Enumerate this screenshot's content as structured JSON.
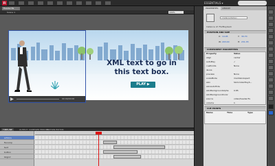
{
  "app": {
    "logo": "Fl",
    "workspace": "ESSENTIALS ▾"
  },
  "document": {
    "tab": "Header.fla",
    "scene": "Scene 1",
    "zoom": "100%"
  },
  "stage": {
    "headline": "XML text to go in this text box.",
    "play_button": "PLAY ▶",
    "video_time": "00:00/00:00"
  },
  "timeline": {
    "tabs": [
      "TIMELINE",
      "OUTPUT",
      "COMPILER ERRORS",
      "MOTION EDITOR"
    ],
    "layers": [
      "actions",
      "flvcomp",
      "text",
      "button",
      "bkgnd"
    ]
  },
  "properties": {
    "tabs": [
      "PROPERTIES",
      "LIBRARY"
    ],
    "instance_placeholder": "<Instance Name>",
    "instance_of": "Instance of: FLVPlayback",
    "sections": {
      "position": "POSITION AND SIZE",
      "component": "COMPONENT PARAMETERS",
      "cue": "CUE POINTS"
    },
    "position": {
      "x_label": "X:",
      "x_value": "14.95",
      "y_label": "Y:",
      "y_value": "30.70",
      "w_label": "W:",
      "w_value": "293.00",
      "h_label": "H:",
      "h_value": "231.35"
    },
    "param_headers": [
      "Property",
      "Value"
    ],
    "params": [
      {
        "name": "align",
        "value": "center"
      },
      {
        "name": "autoPlay",
        "value": "✓"
      },
      {
        "name": "cuePoints",
        "value": "None"
      },
      {
        "name": "isLive",
        "value": ""
      },
      {
        "name": "preview",
        "value": "None"
      },
      {
        "name": "scaleMode",
        "value": "maintainAspect"
      },
      {
        "name": "skin",
        "value": "SkinUnderPlayS..."
      },
      {
        "name": "skinAutoHide",
        "value": ""
      },
      {
        "name": "skinBackgroundAlpha",
        "value": "0.85"
      },
      {
        "name": "skinBackgroundColor",
        "value": ""
      },
      {
        "name": "source",
        "value": "video/header.flv"
      },
      {
        "name": "volume",
        "value": "1"
      }
    ],
    "cue_headers": [
      "Name",
      "Time",
      "Type"
    ]
  }
}
